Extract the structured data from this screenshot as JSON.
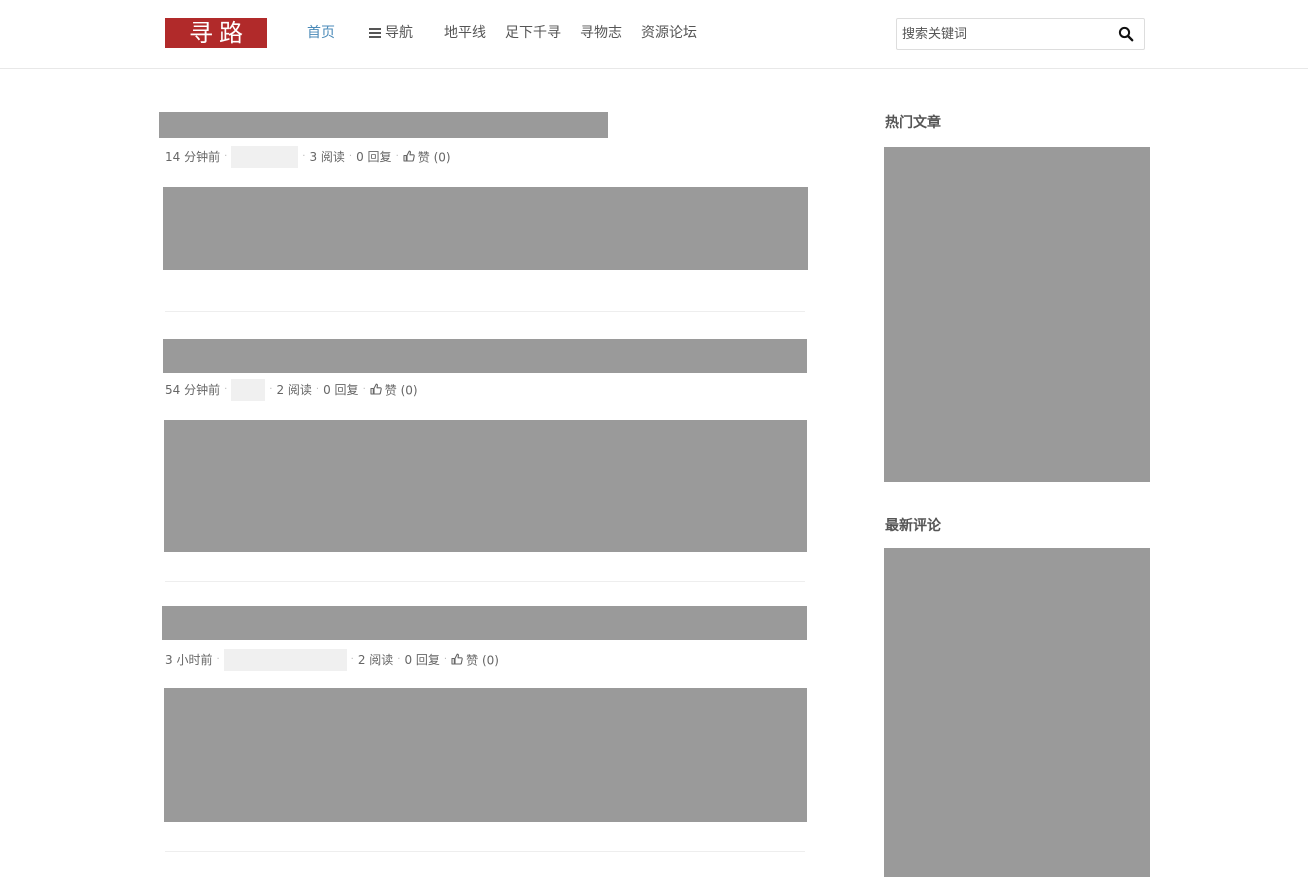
{
  "header": {
    "logo_text": "寻路",
    "logo_color": "#b12a2a",
    "nav": [
      {
        "label": "首页",
        "active": true
      },
      {
        "label": "导航",
        "icon": "menu-icon"
      },
      {
        "label": "地平线"
      },
      {
        "label": "足下千寻"
      },
      {
        "label": "寻物志"
      },
      {
        "label": "资源论坛"
      }
    ],
    "accent_color": "#4a8ab8",
    "search": {
      "placeholder": "搜索关键词",
      "value": "",
      "button_icon": "search-icon"
    }
  },
  "posts": [
    {
      "time": "14 分钟前",
      "reads": "3 阅读",
      "replies": "0 回复",
      "likes_label": "赞",
      "likes_count": "(0)"
    },
    {
      "time": "54 分钟前",
      "reads": "2 阅读",
      "replies": "0 回复",
      "likes_label": "赞",
      "likes_count": "(0)"
    },
    {
      "time": "3 小时前",
      "reads": "2 阅读",
      "replies": "0 回复",
      "likes_label": "赞",
      "likes_count": "(0)"
    }
  ],
  "sidebar": {
    "hot_title": "热门文章",
    "comments_title": "最新评论"
  },
  "colors": {
    "placeholder": "#9a9a9a",
    "author_placeholder": "#f0f0f0"
  }
}
